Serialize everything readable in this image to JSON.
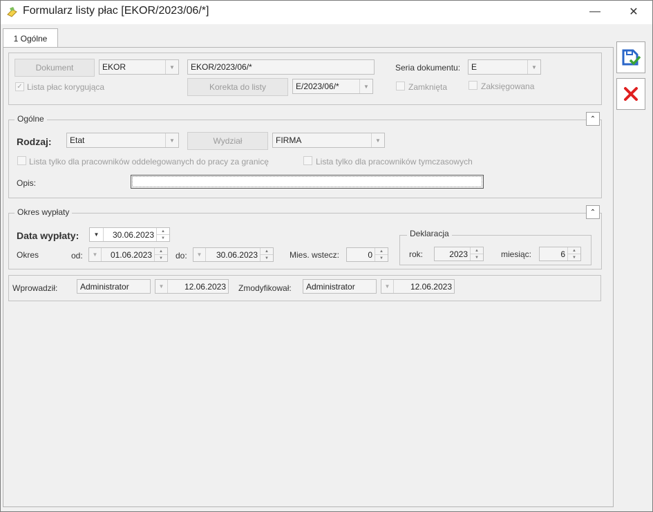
{
  "window": {
    "title": "Formularz listy płac [EKOR/2023/06/*]"
  },
  "tabs": [
    {
      "label": "1 Ogólne"
    }
  ],
  "doc": {
    "dokument_btn": "Dokument",
    "dokument_code": "EKOR",
    "dokument_number": "EKOR/2023/06/*",
    "seria_label": "Seria dokumentu:",
    "seria_value": "E",
    "lista_korygujaca": "Lista płac korygująca",
    "korekta_btn": "Korekta do listy",
    "korekta_value": "E/2023/06/*",
    "zamknieta": "Zamknięta",
    "zaksiegowana": "Zaksięgowana"
  },
  "ogolne": {
    "legend": "Ogólne",
    "rodzaj_label": "Rodzaj:",
    "rodzaj_value": "Etat",
    "wydzial_btn": "Wydział",
    "wydzial_value": "FIRMA",
    "chk_oddelegowani": "Lista tylko dla pracowników oddelegowanych do pracy za granicę",
    "chk_tymczasowi": "Lista tylko dla pracowników tymczasowych",
    "opis_label": "Opis:",
    "opis_value": ""
  },
  "okres": {
    "legend": "Okres wypłaty",
    "data_wyplaty_label": "Data wypłaty:",
    "data_wyplaty_value": "30.06.2023",
    "okres_label": "Okres",
    "od_label": "od:",
    "od_value": "01.06.2023",
    "do_label": "do:",
    "do_value": "30.06.2023",
    "mies_label": "Mies. wstecz:",
    "mies_value": "0",
    "deklaracja_legend": "Deklaracja",
    "rok_label": "rok:",
    "rok_value": "2023",
    "miesiac_label": "miesiąc:",
    "miesiac_value": "6"
  },
  "footer": {
    "wprowadzil_label": "Wprowadził:",
    "wprowadzil_user": "Administrator",
    "wprowadzil_date": "12.06.2023",
    "zmodyfikowal_label": "Zmodyfikował:",
    "zmodyfikowal_user": "Administrator",
    "zmodyfikowal_date": "12.06.2023"
  },
  "icons": {
    "save": "save-check-icon",
    "cancel": "cancel-x-icon",
    "colors": {
      "save_blue": "#2a66c8",
      "save_green": "#3aa335",
      "cancel_red": "#e02020"
    }
  }
}
